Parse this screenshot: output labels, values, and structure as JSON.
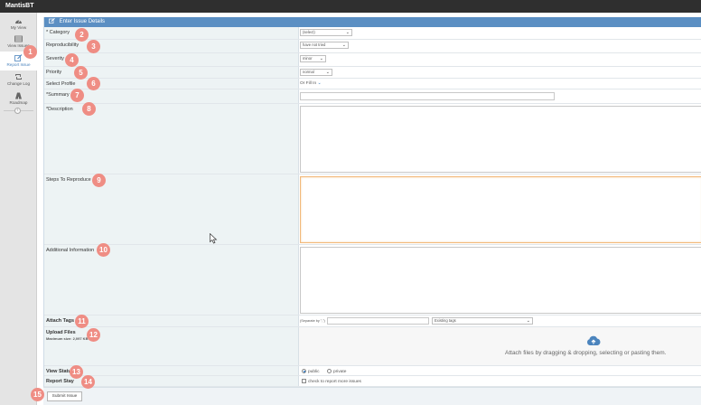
{
  "app": {
    "title": "MantisBT"
  },
  "sidebar": {
    "items": [
      {
        "label": "My View",
        "icon": "dashboard-icon"
      },
      {
        "label": "View Issues",
        "icon": "list-icon"
      },
      {
        "label": "Report Issue",
        "icon": "edit-icon",
        "active": true
      },
      {
        "label": "Change Log",
        "icon": "retweet-icon"
      },
      {
        "label": "Roadmap",
        "icon": "road-icon"
      }
    ],
    "collapse_glyph": "‹"
  },
  "form": {
    "header": "Enter Issue Details",
    "category": {
      "label": "* Category",
      "value": "(select)"
    },
    "reproducibility": {
      "label": "Reproducibility",
      "value": "have not tried"
    },
    "severity": {
      "label": "Severity",
      "value": "minor"
    },
    "priority": {
      "label": "Priority",
      "value": "normal"
    },
    "profile": {
      "label": "Select Profile",
      "value": "Or Fill In"
    },
    "summary": {
      "label": "*Summary",
      "value": ""
    },
    "description": {
      "label": "*Description",
      "value": ""
    },
    "steps": {
      "label": "Steps To Reproduce",
      "value": ""
    },
    "additional": {
      "label": "Additional Information",
      "value": ""
    },
    "tags": {
      "label": "Attach Tags",
      "hint": "(Separate by \",\")",
      "existing": "Existing tags"
    },
    "upload": {
      "label": "Upload Files",
      "sub": "Maximum size: 2,097 KB",
      "message": "Attach files by dragging & dropping, selecting or pasting them."
    },
    "view_status": {
      "label": "View Status",
      "public": "public",
      "private": "private"
    },
    "report_stay": {
      "label": "Report Stay",
      "option": "check to report more issues"
    },
    "submit": "Submit Issue"
  },
  "badges": [
    "1",
    "2",
    "3",
    "4",
    "5",
    "6",
    "7",
    "8",
    "9",
    "10",
    "11",
    "12",
    "13",
    "14",
    "15"
  ],
  "colors": {
    "header": "#5b8fc3",
    "badge": "#ef8d84",
    "topbar": "#2f2f2f",
    "label_bg": "#edf3f4"
  }
}
